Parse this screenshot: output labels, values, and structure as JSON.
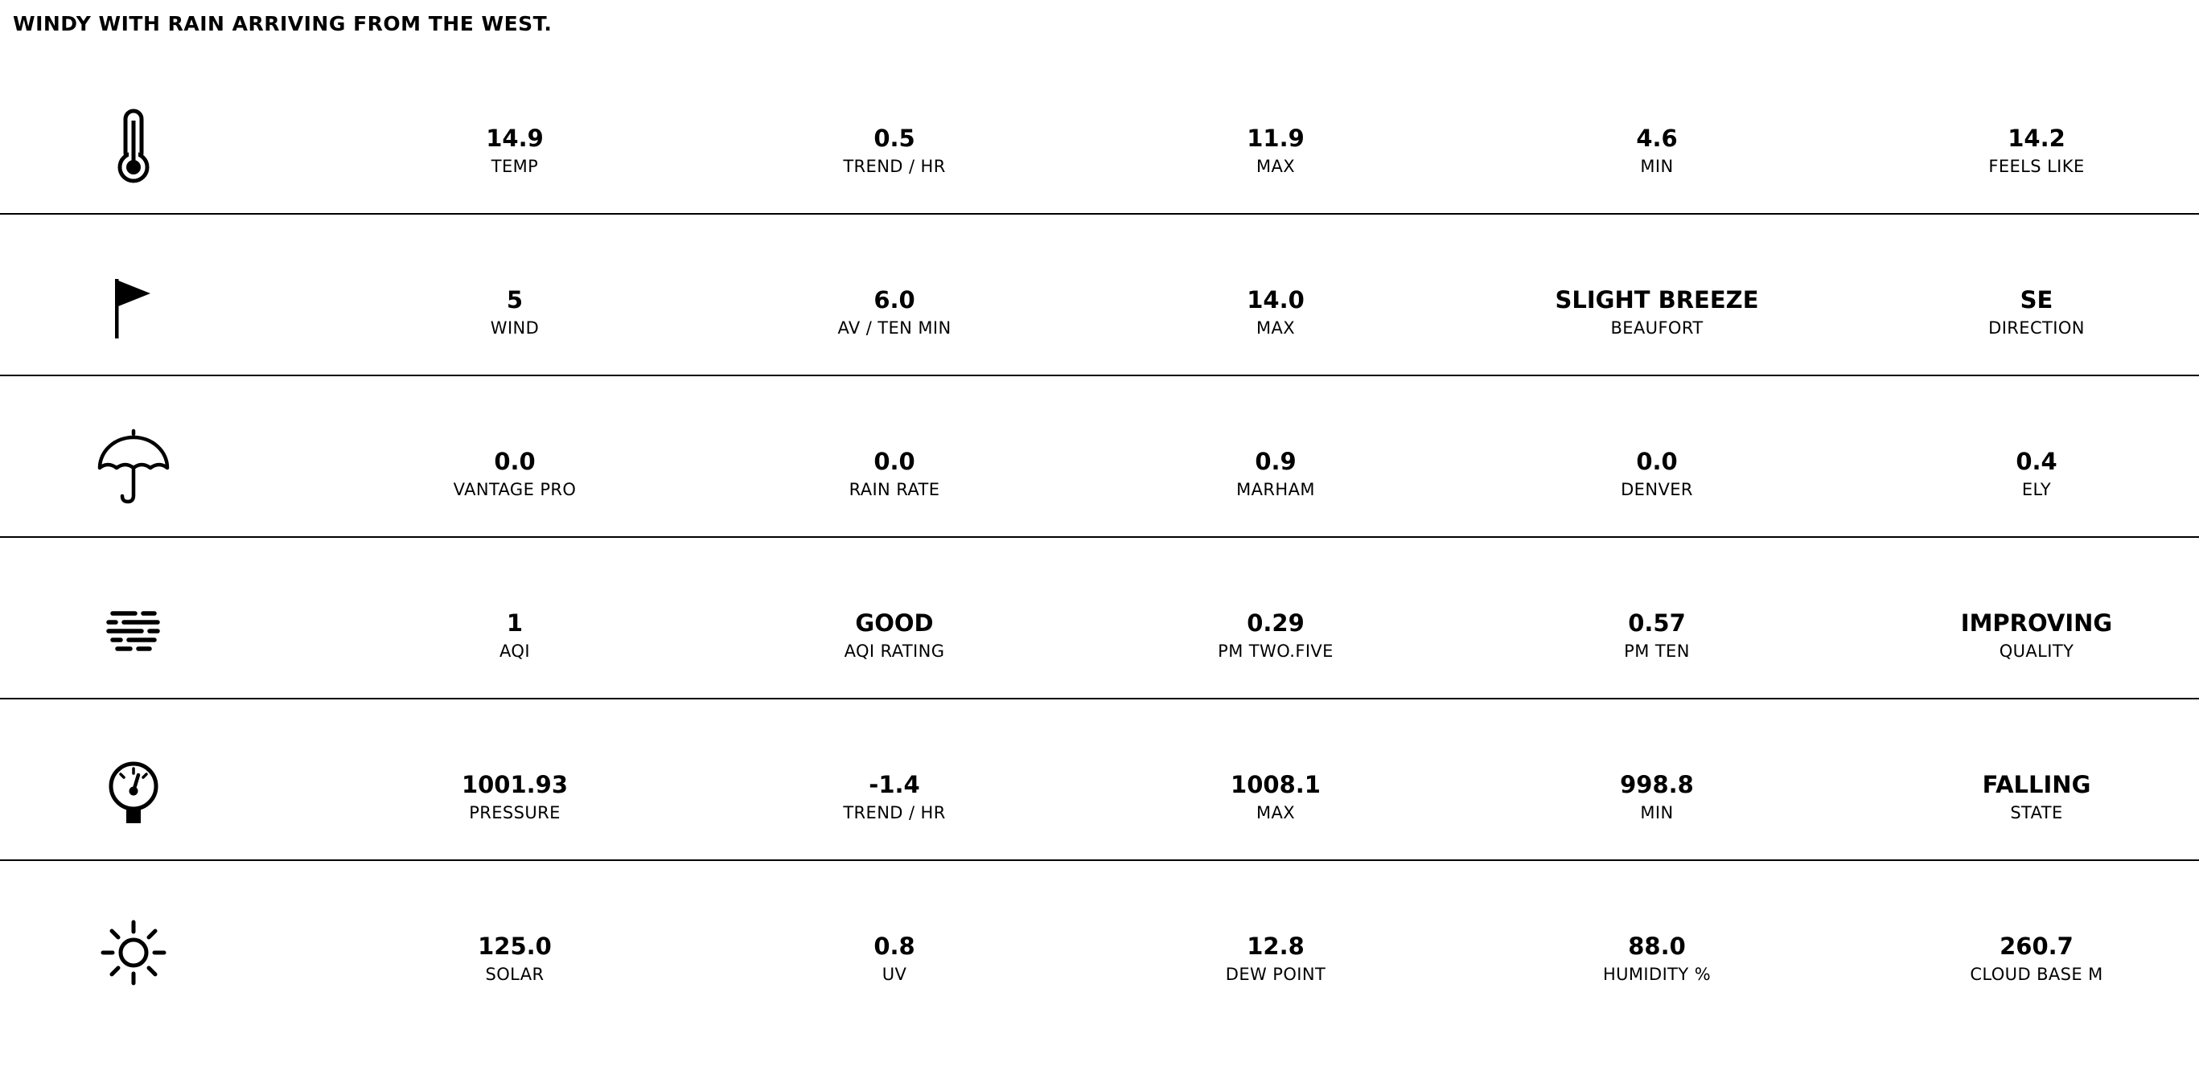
{
  "headline": "WINDY WITH RAIN ARRIVING FROM THE WEST.",
  "rows": [
    {
      "icon": "thermometer-icon",
      "cells": [
        {
          "value": "14.9",
          "label": "TEMP"
        },
        {
          "value": "0.5",
          "label": "TREND / HR"
        },
        {
          "value": "11.9",
          "label": "MAX"
        },
        {
          "value": "4.6",
          "label": "MIN"
        },
        {
          "value": "14.2",
          "label": "FEELS LIKE"
        }
      ]
    },
    {
      "icon": "flag-icon",
      "cells": [
        {
          "value": "5",
          "label": "WIND"
        },
        {
          "value": "6.0",
          "label": "AV / TEN MIN"
        },
        {
          "value": "14.0",
          "label": "MAX"
        },
        {
          "value": "SLIGHT BREEZE",
          "label": "BEAUFORT"
        },
        {
          "value": "SE",
          "label": "DIRECTION"
        }
      ]
    },
    {
      "icon": "umbrella-icon",
      "cells": [
        {
          "value": "0.0",
          "label": "VANTAGE PRO"
        },
        {
          "value": "0.0",
          "label": "RAIN RATE"
        },
        {
          "value": "0.9",
          "label": "MARHAM"
        },
        {
          "value": "0.0",
          "label": "DENVER"
        },
        {
          "value": "0.4",
          "label": "ELY"
        }
      ]
    },
    {
      "icon": "haze-icon",
      "cells": [
        {
          "value": "1",
          "label": "AQI"
        },
        {
          "value": "GOOD",
          "label": "AQI RATING"
        },
        {
          "value": "0.29",
          "label": "PM TWO.FIVE"
        },
        {
          "value": "0.57",
          "label": "PM TEN"
        },
        {
          "value": "IMPROVING",
          "label": "QUALITY"
        }
      ]
    },
    {
      "icon": "pressure-gauge-icon",
      "cells": [
        {
          "value": "1001.93",
          "label": "PRESSURE"
        },
        {
          "value": "-1.4",
          "label": "TREND / HR"
        },
        {
          "value": "1008.1",
          "label": "MAX"
        },
        {
          "value": "998.8",
          "label": "MIN"
        },
        {
          "value": "FALLING",
          "label": "STATE"
        }
      ]
    },
    {
      "icon": "sun-icon",
      "cells": [
        {
          "value": "125.0",
          "label": "SOLAR"
        },
        {
          "value": "0.8",
          "label": "UV"
        },
        {
          "value": "12.8",
          "label": "DEW POINT"
        },
        {
          "value": "88.0",
          "label": "HUMIDITY %"
        },
        {
          "value": "260.7",
          "label": "CLOUD BASE M"
        }
      ]
    }
  ]
}
